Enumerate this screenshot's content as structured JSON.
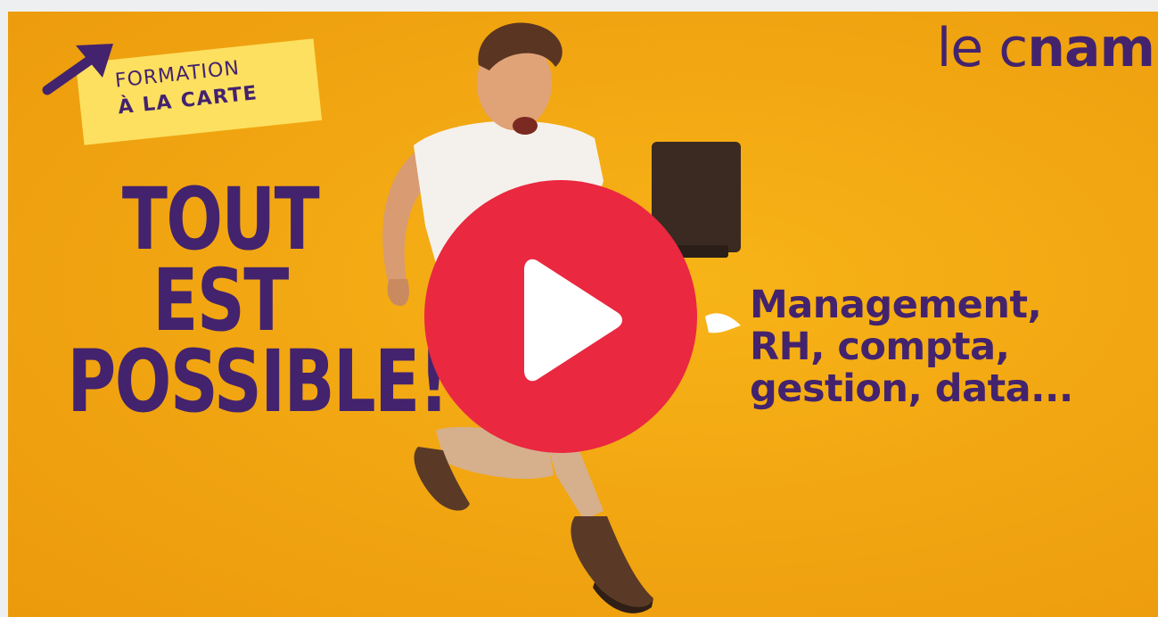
{
  "video": {
    "tag_line1": "FORMATION",
    "tag_line2": "À LA CARTE",
    "headline": [
      "TOUT",
      "EST",
      "POSSIBLE!"
    ],
    "logo_light": "le c",
    "logo_bold": "nam",
    "subtitle": [
      "Management,",
      "RH, compta,",
      "gestion, data..."
    ],
    "play_icon": "play-icon",
    "arrow_icon": "arrow-up-right-icon"
  },
  "colors": {
    "background": "#f2a712",
    "text_purple": "#43236e",
    "tag_yellow": "#fde05f",
    "play_red": "#ea2840"
  }
}
